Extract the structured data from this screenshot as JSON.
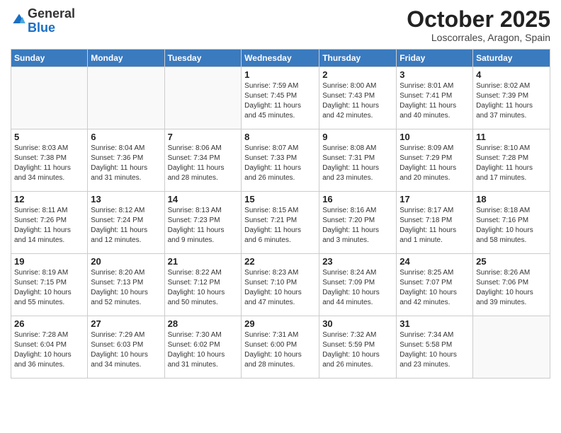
{
  "logo": {
    "general": "General",
    "blue": "Blue"
  },
  "header": {
    "month": "October 2025",
    "location": "Loscorrales, Aragon, Spain"
  },
  "weekdays": [
    "Sunday",
    "Monday",
    "Tuesday",
    "Wednesday",
    "Thursday",
    "Friday",
    "Saturday"
  ],
  "weeks": [
    [
      {
        "day": "",
        "info": ""
      },
      {
        "day": "",
        "info": ""
      },
      {
        "day": "",
        "info": ""
      },
      {
        "day": "1",
        "info": "Sunrise: 7:59 AM\nSunset: 7:45 PM\nDaylight: 11 hours\nand 45 minutes."
      },
      {
        "day": "2",
        "info": "Sunrise: 8:00 AM\nSunset: 7:43 PM\nDaylight: 11 hours\nand 42 minutes."
      },
      {
        "day": "3",
        "info": "Sunrise: 8:01 AM\nSunset: 7:41 PM\nDaylight: 11 hours\nand 40 minutes."
      },
      {
        "day": "4",
        "info": "Sunrise: 8:02 AM\nSunset: 7:39 PM\nDaylight: 11 hours\nand 37 minutes."
      }
    ],
    [
      {
        "day": "5",
        "info": "Sunrise: 8:03 AM\nSunset: 7:38 PM\nDaylight: 11 hours\nand 34 minutes."
      },
      {
        "day": "6",
        "info": "Sunrise: 8:04 AM\nSunset: 7:36 PM\nDaylight: 11 hours\nand 31 minutes."
      },
      {
        "day": "7",
        "info": "Sunrise: 8:06 AM\nSunset: 7:34 PM\nDaylight: 11 hours\nand 28 minutes."
      },
      {
        "day": "8",
        "info": "Sunrise: 8:07 AM\nSunset: 7:33 PM\nDaylight: 11 hours\nand 26 minutes."
      },
      {
        "day": "9",
        "info": "Sunrise: 8:08 AM\nSunset: 7:31 PM\nDaylight: 11 hours\nand 23 minutes."
      },
      {
        "day": "10",
        "info": "Sunrise: 8:09 AM\nSunset: 7:29 PM\nDaylight: 11 hours\nand 20 minutes."
      },
      {
        "day": "11",
        "info": "Sunrise: 8:10 AM\nSunset: 7:28 PM\nDaylight: 11 hours\nand 17 minutes."
      }
    ],
    [
      {
        "day": "12",
        "info": "Sunrise: 8:11 AM\nSunset: 7:26 PM\nDaylight: 11 hours\nand 14 minutes."
      },
      {
        "day": "13",
        "info": "Sunrise: 8:12 AM\nSunset: 7:24 PM\nDaylight: 11 hours\nand 12 minutes."
      },
      {
        "day": "14",
        "info": "Sunrise: 8:13 AM\nSunset: 7:23 PM\nDaylight: 11 hours\nand 9 minutes."
      },
      {
        "day": "15",
        "info": "Sunrise: 8:15 AM\nSunset: 7:21 PM\nDaylight: 11 hours\nand 6 minutes."
      },
      {
        "day": "16",
        "info": "Sunrise: 8:16 AM\nSunset: 7:20 PM\nDaylight: 11 hours\nand 3 minutes."
      },
      {
        "day": "17",
        "info": "Sunrise: 8:17 AM\nSunset: 7:18 PM\nDaylight: 11 hours\nand 1 minute."
      },
      {
        "day": "18",
        "info": "Sunrise: 8:18 AM\nSunset: 7:16 PM\nDaylight: 10 hours\nand 58 minutes."
      }
    ],
    [
      {
        "day": "19",
        "info": "Sunrise: 8:19 AM\nSunset: 7:15 PM\nDaylight: 10 hours\nand 55 minutes."
      },
      {
        "day": "20",
        "info": "Sunrise: 8:20 AM\nSunset: 7:13 PM\nDaylight: 10 hours\nand 52 minutes."
      },
      {
        "day": "21",
        "info": "Sunrise: 8:22 AM\nSunset: 7:12 PM\nDaylight: 10 hours\nand 50 minutes."
      },
      {
        "day": "22",
        "info": "Sunrise: 8:23 AM\nSunset: 7:10 PM\nDaylight: 10 hours\nand 47 minutes."
      },
      {
        "day": "23",
        "info": "Sunrise: 8:24 AM\nSunset: 7:09 PM\nDaylight: 10 hours\nand 44 minutes."
      },
      {
        "day": "24",
        "info": "Sunrise: 8:25 AM\nSunset: 7:07 PM\nDaylight: 10 hours\nand 42 minutes."
      },
      {
        "day": "25",
        "info": "Sunrise: 8:26 AM\nSunset: 7:06 PM\nDaylight: 10 hours\nand 39 minutes."
      }
    ],
    [
      {
        "day": "26",
        "info": "Sunrise: 7:28 AM\nSunset: 6:04 PM\nDaylight: 10 hours\nand 36 minutes."
      },
      {
        "day": "27",
        "info": "Sunrise: 7:29 AM\nSunset: 6:03 PM\nDaylight: 10 hours\nand 34 minutes."
      },
      {
        "day": "28",
        "info": "Sunrise: 7:30 AM\nSunset: 6:02 PM\nDaylight: 10 hours\nand 31 minutes."
      },
      {
        "day": "29",
        "info": "Sunrise: 7:31 AM\nSunset: 6:00 PM\nDaylight: 10 hours\nand 28 minutes."
      },
      {
        "day": "30",
        "info": "Sunrise: 7:32 AM\nSunset: 5:59 PM\nDaylight: 10 hours\nand 26 minutes."
      },
      {
        "day": "31",
        "info": "Sunrise: 7:34 AM\nSunset: 5:58 PM\nDaylight: 10 hours\nand 23 minutes."
      },
      {
        "day": "",
        "info": ""
      }
    ]
  ]
}
